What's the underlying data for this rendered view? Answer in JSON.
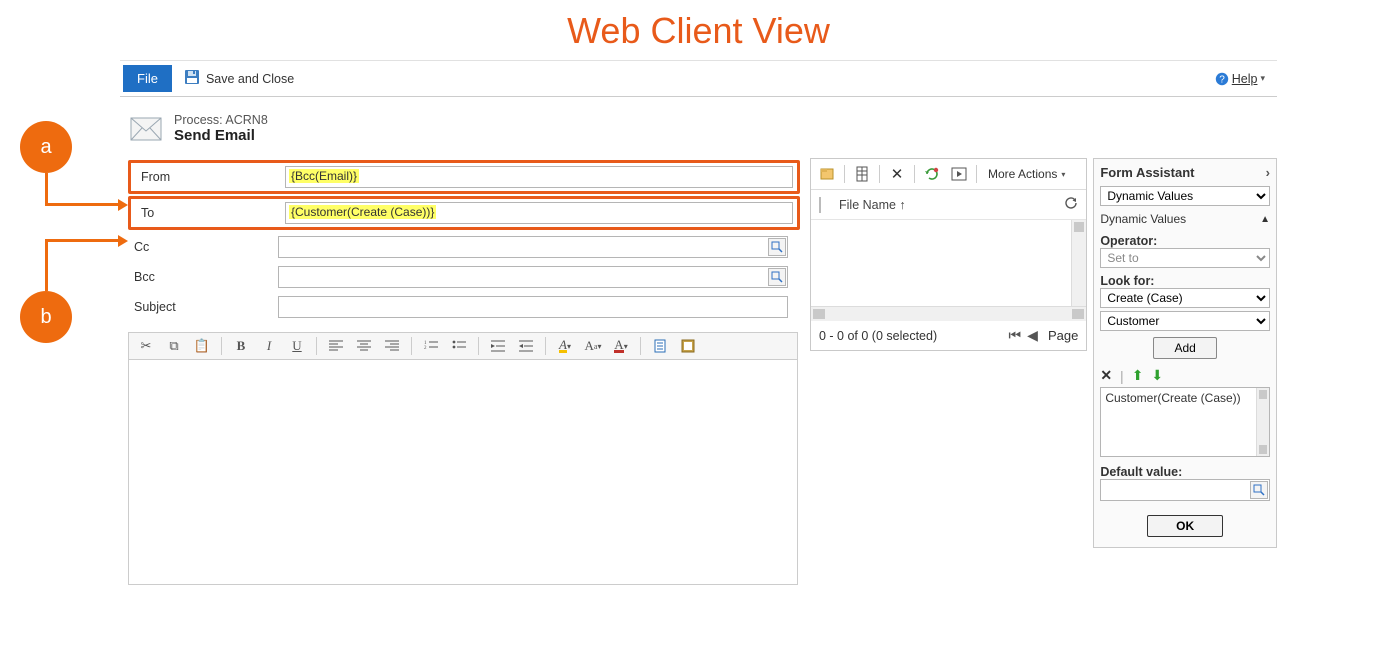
{
  "page_title": "Web Client View",
  "callouts": {
    "a": "a",
    "b": "b"
  },
  "topbar": {
    "file": "File",
    "save_close": "Save and Close",
    "help": "Help"
  },
  "header": {
    "process_line": "Process: ACRN8",
    "title": "Send Email"
  },
  "fields": {
    "from_label": "From",
    "from_value": "{Bcc(Email)}",
    "to_label": "To",
    "to_value": "{Customer(Create (Case))}",
    "cc_label": "Cc",
    "bcc_label": "Bcc",
    "subject_label": "Subject"
  },
  "attachments": {
    "more_actions": "More Actions",
    "file_name_col": "File Name ↑",
    "status": "0 - 0 of 0 (0 selected)",
    "page_label": "Page"
  },
  "assistant": {
    "title": "Form Assistant",
    "dropdown": "Dynamic Values",
    "section": "Dynamic Values",
    "operator_label": "Operator:",
    "operator_value": "Set to",
    "lookfor_label": "Look for:",
    "lookfor_entity": "Create (Case)",
    "lookfor_field": "Customer",
    "add_btn": "Add",
    "list_item": "Customer(Create (Case))",
    "default_label": "Default value:",
    "ok_btn": "OK"
  }
}
